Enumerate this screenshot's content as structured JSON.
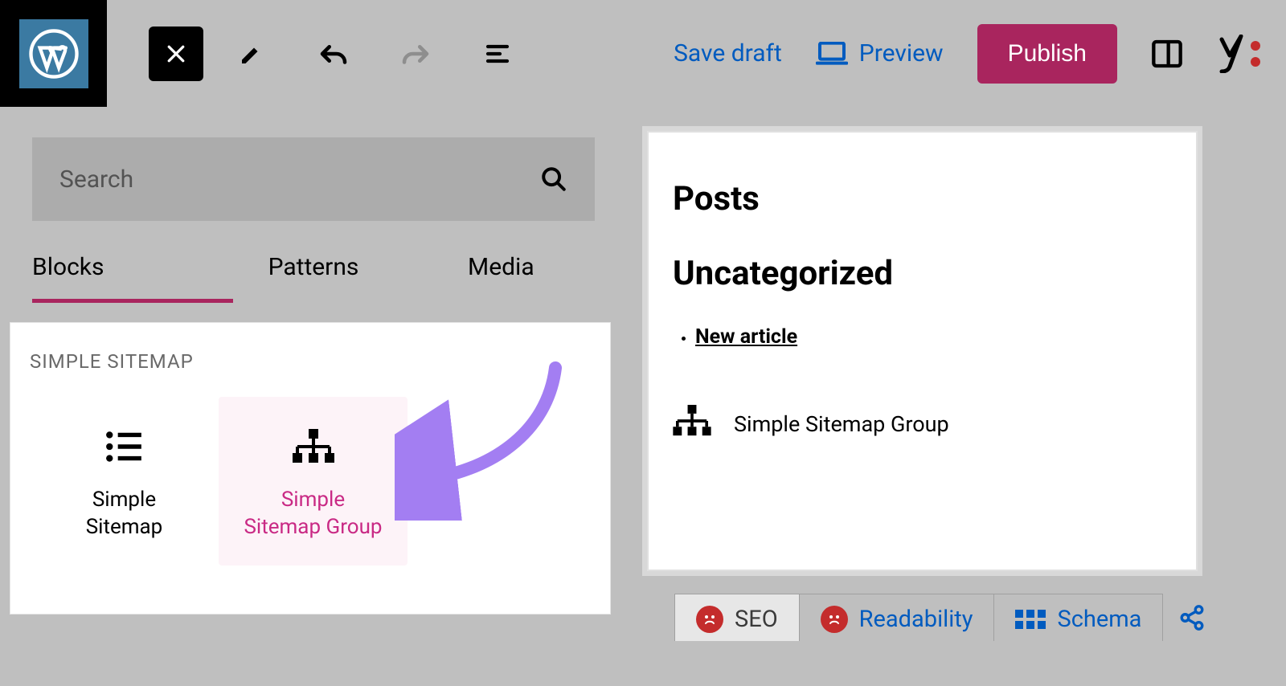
{
  "topbar": {
    "save_draft": "Save draft",
    "preview": "Preview",
    "publish": "Publish"
  },
  "inserter": {
    "search_placeholder": "Search",
    "tabs": {
      "blocks": "Blocks",
      "patterns": "Patterns",
      "media": "Media"
    },
    "section_label": "SIMPLE SITEMAP",
    "blocks": [
      {
        "name": "Simple\nSitemap"
      },
      {
        "name": "Simple\nSitemap Group"
      }
    ]
  },
  "canvas": {
    "heading_posts": "Posts",
    "heading_category": "Uncategorized",
    "articles": [
      {
        "title": "New article"
      }
    ],
    "block_placeholder_label": "Simple Sitemap Group"
  },
  "yoast": {
    "seo": "SEO",
    "readability": "Readability",
    "schema": "Schema"
  }
}
